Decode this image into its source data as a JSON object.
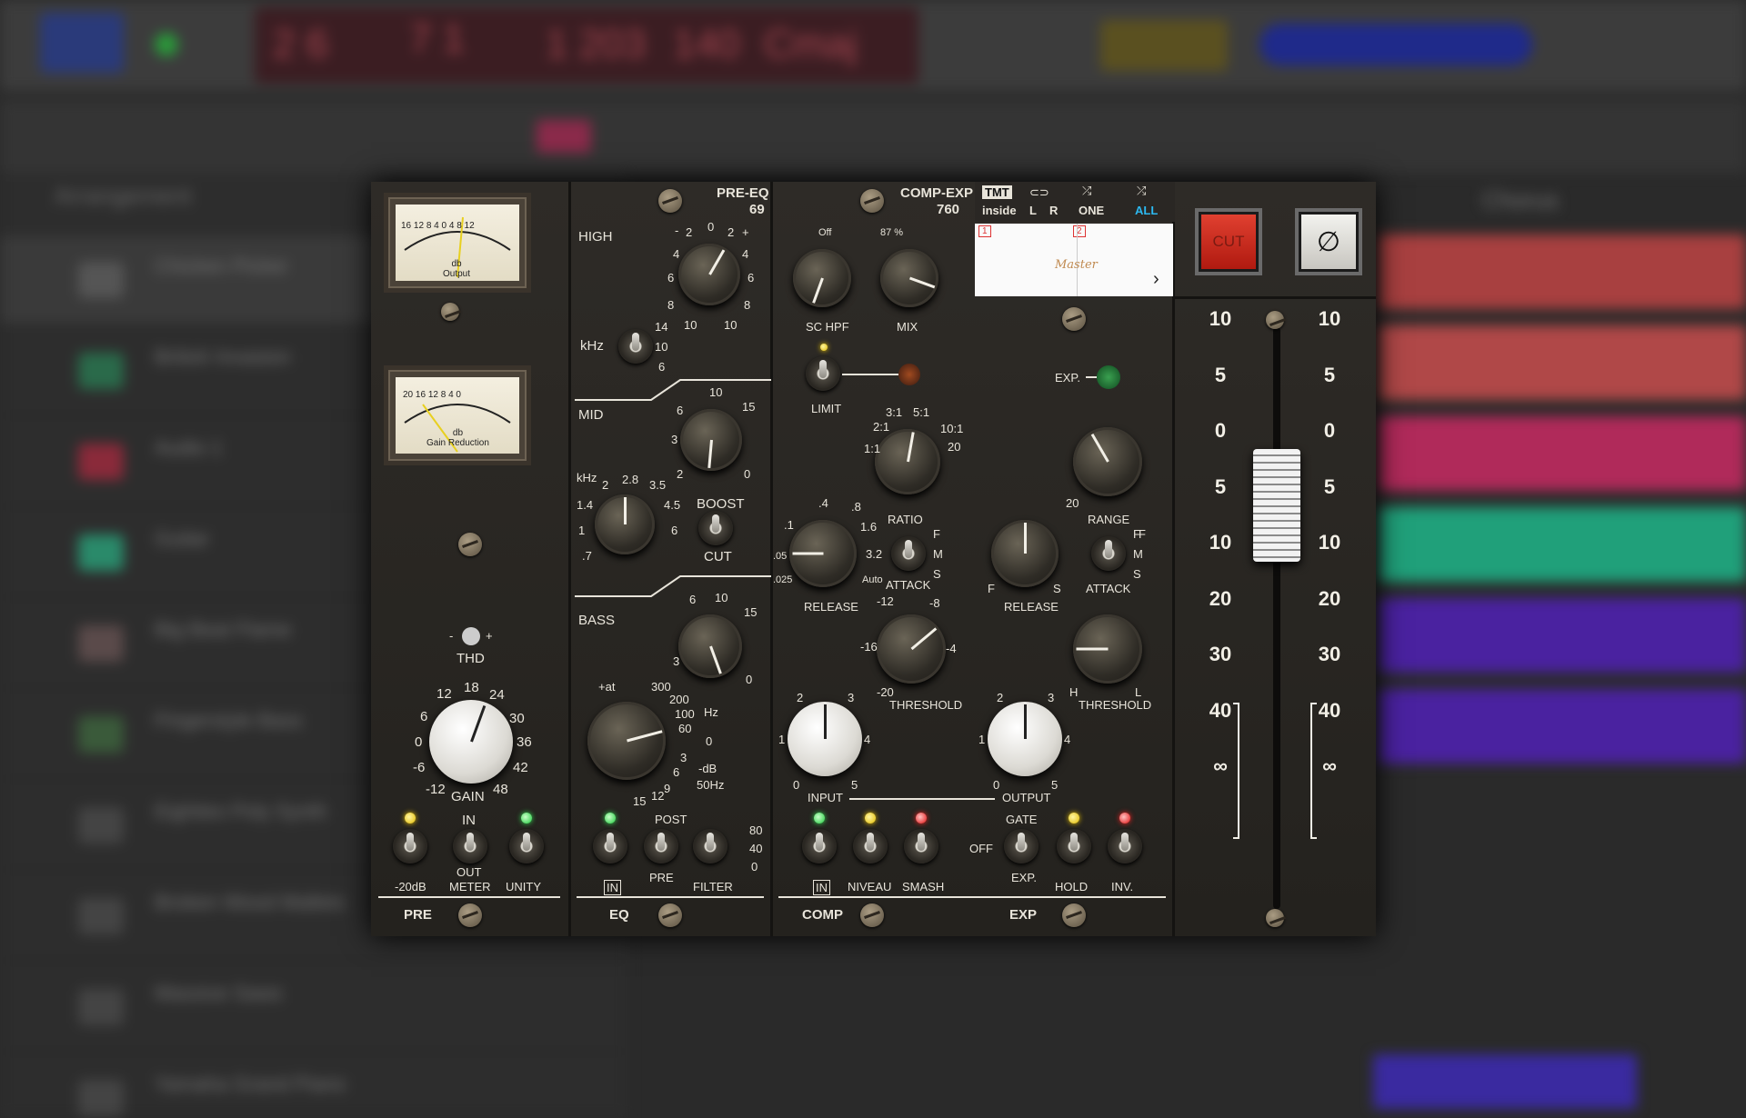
{
  "background": {
    "tracks": [
      "Chicken Picker",
      "British Invasion",
      "Audio 1",
      "Guitar",
      "Big Beat Flame",
      "Fingerstyle Bass",
      "Eighties Poly Synth",
      "Broken Wood Mallets",
      "Massive Saws",
      "Yamaha Grand Piano"
    ],
    "arrangement_label": "Arrangement",
    "chorus_label": "Chorus"
  },
  "plugin": {
    "pre": {
      "meter_output_label": "db\nOutput",
      "meter_output_ticks": [
        "16",
        "12",
        "8",
        "4",
        "0",
        "4",
        "8",
        "12"
      ],
      "meter_gr_label": "db\nGain Reduction",
      "meter_gr_ticks": [
        "20",
        "16",
        "12",
        "8",
        "4",
        "0"
      ],
      "thd_label": "THD",
      "thd_minus": "-",
      "thd_plus": "+",
      "gain_label": "GAIN",
      "gain_ticks": [
        "12",
        "18",
        "24",
        "6",
        "30",
        "0",
        "36",
        "-6",
        "42",
        "-12",
        "48"
      ],
      "switch_20db": "-20dB",
      "switch_in": "IN",
      "switch_out": "OUT",
      "switch_meter": "METER",
      "switch_unity": "UNITY",
      "section_label": "PRE"
    },
    "eq": {
      "header": "PRE-EQ",
      "header_num": "69",
      "high_label": "HIGH",
      "high_ticks": [
        "-",
        "2",
        "0",
        "2",
        "+",
        "4",
        "4",
        "6",
        "6",
        "8",
        "8",
        "10",
        "10"
      ],
      "khz_label": "kHz",
      "khz_ticks": [
        "14",
        "10",
        "6"
      ],
      "mid_label": "MID",
      "mid_gain_ticks": [
        "10",
        "6",
        "15",
        "3",
        "2",
        "0"
      ],
      "mid_freq_label": "kHz",
      "mid_freq_ticks": [
        "2",
        "2.8",
        "3.5",
        "1.4",
        "4.5",
        "1",
        "6",
        ".7"
      ],
      "boost_label": "BOOST",
      "cut_label": "CUT",
      "bass_label": "BASS",
      "bass_gain_ticks": [
        "6",
        "10",
        "15",
        "3",
        "0"
      ],
      "bass_freq_ticks": [
        "+at",
        "300",
        "200",
        "100",
        "60",
        "0",
        "3",
        "6",
        "9",
        "12",
        "15"
      ],
      "hz_label": "Hz",
      "db_label": "-dB",
      "hz50_label": "50Hz",
      "in_label": "IN",
      "post_label": "POST",
      "pre_label": "PRE",
      "filter_label": "FILTER",
      "filter_ticks": [
        "80",
        "40",
        "0"
      ],
      "section_label": "EQ"
    },
    "comp": {
      "header": "COMP-EXP",
      "header_num": "760",
      "schpf_label": "SC HPF",
      "schpf_top": "Off",
      "mix_label": "MIX",
      "mix_top": "87 %",
      "limit_label": "LIMIT",
      "ratio_label": "RATIO",
      "ratio_ticks": [
        "3:1",
        "5:1",
        "2:1",
        "10:1",
        "1:1",
        "20"
      ],
      "release_label": "RELEASE",
      "release_ticks": [
        ".4",
        ".8",
        ".1",
        "1.6",
        ".05",
        "3.2",
        ".025",
        "Auto"
      ],
      "attack_label": "ATTACK",
      "attack_fms": [
        "F",
        "M",
        "S"
      ],
      "threshold_label": "THRESHOLD",
      "threshold_ticks": [
        "-12",
        "-8",
        "-16",
        "-4",
        "-20"
      ],
      "input_label": "INPUT",
      "input_ticks": [
        "2",
        "3",
        "1",
        "4",
        "0",
        "5"
      ],
      "niveau_label": "NIVEAU",
      "smash_label": "SMASH",
      "in_label": "IN",
      "section_label": "COMP"
    },
    "exp": {
      "tmt_label": "TMT",
      "inside_label": "inside",
      "l_label": "L",
      "r_label": "R",
      "one_label": "ONE",
      "all_label": "ALL",
      "preset_slot_1": "1",
      "preset_slot_2": "2",
      "preset_name": "Master",
      "exp_label": "EXP.",
      "range_label": "RANGE",
      "range_ticks": [
        "20",
        "F"
      ],
      "release_label": "RELEASE",
      "release_fs": [
        "F",
        "S"
      ],
      "attack_label": "ATTACK",
      "attack_fms": [
        "F",
        "M",
        "S"
      ],
      "threshold_label": "THRESHOLD",
      "threshold_hl": [
        "H",
        "L"
      ],
      "output_label": "OUTPUT",
      "output_ticks": [
        "2",
        "3",
        "1",
        "4",
        "0",
        "5"
      ],
      "gate_label": "GATE",
      "off_label": "OFF",
      "exp_switch_label": "EXP.",
      "hold_label": "HOLD",
      "inv_label": "INV.",
      "section_label": "EXP"
    },
    "fader": {
      "cut_label": "CUT",
      "phase_symbol": "∅",
      "scale": [
        "10",
        "5",
        "0",
        "5",
        "10",
        "20",
        "30",
        "40",
        "∞"
      ]
    }
  }
}
